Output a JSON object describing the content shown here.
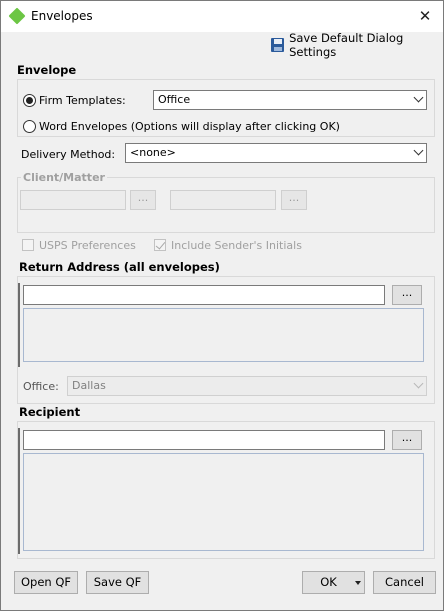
{
  "window": {
    "title": "Envelopes",
    "close_glyph": "✕"
  },
  "toolbar": {
    "save_default_label": "Save Default Dialog Settings"
  },
  "envelope": {
    "section_label": "Envelope",
    "firm_templates_label": "Firm Templates:",
    "firm_templates_value": "Office",
    "word_envelopes_label": "Word Envelopes (Options will display after clicking OK)",
    "delivery_method_label": "Delivery Method:",
    "delivery_method_value": "<none>",
    "client_matter_label": "Client/Matter",
    "client_button_label": "...",
    "matter_button_label": "...",
    "usps_label": "USPS Preferences",
    "include_initials_label": "Include Sender's Initials"
  },
  "return_address": {
    "section_label": "Return Address (all envelopes)",
    "lookup_button_label": "...",
    "office_label": "Office:",
    "office_value": "Dallas"
  },
  "recipient": {
    "section_label": "Recipient",
    "lookup_button_label": "..."
  },
  "footer": {
    "open_qf_label": "Open QF",
    "save_qf_label": "Save QF",
    "ok_label": "OK",
    "cancel_label": "Cancel"
  },
  "colors": {
    "accent_icon": "#6cc644",
    "save_icon": "#2a5a9b"
  }
}
